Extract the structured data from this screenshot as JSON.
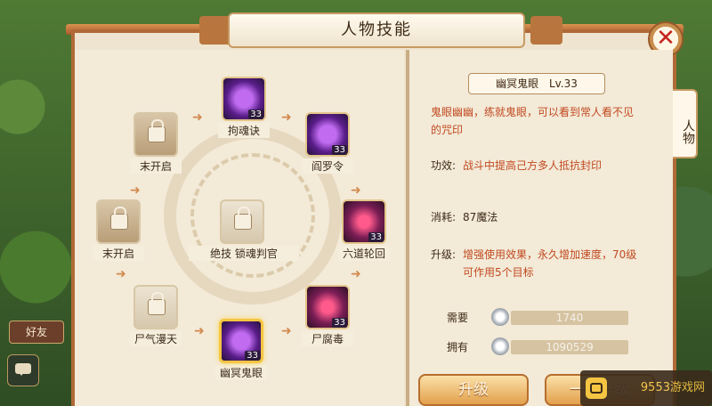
{
  "window": {
    "title": "人物技能",
    "close_label": "✕",
    "side_tab": "人物"
  },
  "hud": {
    "friends_label": "好友"
  },
  "skills": [
    {
      "name": "拘魂诀",
      "level": "33",
      "state": "active",
      "icon": "purple-spirit-icon"
    },
    {
      "name": "阎罗令",
      "level": "33",
      "state": "active",
      "icon": "purple-rune-icon"
    },
    {
      "name": "六道轮回",
      "level": "33",
      "state": "active",
      "icon": "red-demon-icon"
    },
    {
      "name": "尸腐毒",
      "level": "33",
      "state": "active",
      "icon": "red-poison-icon"
    },
    {
      "name": "幽冥鬼眼",
      "level": "33",
      "state": "selected",
      "icon": "purple-eye-icon"
    },
    {
      "name": "尸气漫天",
      "level": "",
      "state": "locked",
      "icon": "lock-icon"
    },
    {
      "name": "末开启",
      "level": "",
      "state": "locked",
      "icon": "lock-icon"
    },
    {
      "name": "末开启",
      "level": "",
      "state": "locked",
      "icon": "lock-icon"
    }
  ],
  "center_skill": {
    "name": "绝技  锁魂判官",
    "state": "locked",
    "icon": "lock-icon"
  },
  "detail": {
    "name": "幽冥鬼眼",
    "level": "Lv.33",
    "description": "鬼眼幽幽，练就鬼眼，可以看到常人看不见的咒印",
    "effect_label": "功效:",
    "effect": "战斗中提高己方多人抵抗封印",
    "cost_label": "消耗:",
    "cost": "87魔法",
    "upgrade_label": "升级:",
    "upgrade": "增强使用效果，永久增加速度，70级可作用5个目标"
  },
  "resources": {
    "need_label": "需要",
    "need_value": "1740",
    "have_label": "拥有",
    "have_value": "1090529",
    "coin_icon": "silver-coin-icon"
  },
  "buttons": {
    "upgrade": "升级",
    "one_click_upgrade": "一键升级"
  },
  "watermark": "9553游戏网"
}
